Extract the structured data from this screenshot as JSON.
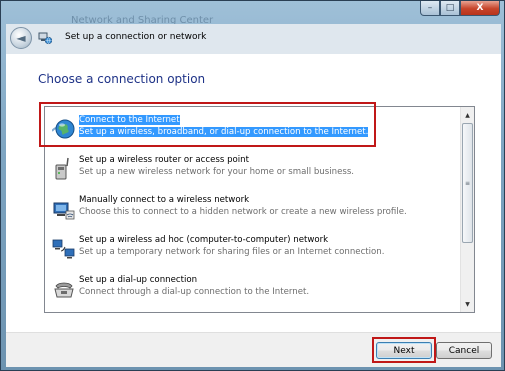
{
  "window": {
    "background_title": "Network and Sharing Center",
    "controls": {
      "minimize": "–",
      "maximize": "□",
      "close": "X"
    }
  },
  "nav": {
    "back_glyph": "◄",
    "title": "Set up a connection or network"
  },
  "main": {
    "heading": "Choose a connection option",
    "options": [
      {
        "title": "Connect to the Internet",
        "description": "Set up a wireless, broadband, or dial-up connection to the Internet.",
        "icon": "globe-network-icon",
        "selected": true
      },
      {
        "title": "Set up a wireless router or access point",
        "description": "Set up a new wireless network for your home or small business.",
        "icon": "router-icon",
        "selected": false
      },
      {
        "title": "Manually connect to a wireless network",
        "description": "Choose this to connect to a hidden network or create a new wireless profile.",
        "icon": "wireless-computer-icon",
        "selected": false
      },
      {
        "title": "Set up a wireless ad hoc (computer-to-computer) network",
        "description": "Set up a temporary network for sharing files or an Internet connection.",
        "icon": "adhoc-network-icon",
        "selected": false
      },
      {
        "title": "Set up a dial-up connection",
        "description": "Connect through a dial-up connection to the Internet.",
        "icon": "telephone-modem-icon",
        "selected": false
      }
    ],
    "scrollbar": {
      "up": "▲",
      "down": "▼",
      "grip": "≡"
    }
  },
  "footer": {
    "next_label": "Next",
    "cancel_label": "Cancel"
  },
  "colors": {
    "heading": "#1e3287",
    "selection": "#3399ff",
    "annotation": "#c01818"
  }
}
